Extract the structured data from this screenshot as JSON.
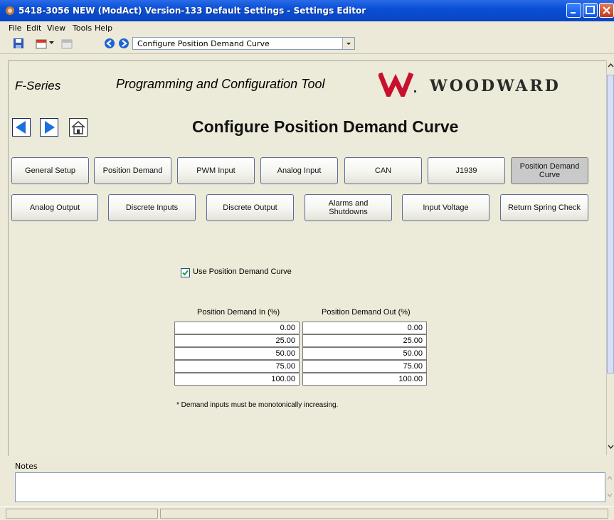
{
  "window": {
    "title": "5418-3056 NEW (ModAct) Version-133 Default Settings - Settings Editor"
  },
  "menu": [
    "File",
    "Edit",
    "View",
    "Tools",
    "Help"
  ],
  "toolbar": {
    "page_select": "Configure Position Demand Curve",
    "icons": [
      "save-icon",
      "calendar-icon",
      "calendar-disabled-icon",
      "back-circle-icon",
      "forward-circle-icon"
    ]
  },
  "header": {
    "series": "F-Series",
    "tool": "Programming and Configuration Tool",
    "brand": "WOODWARD"
  },
  "page": {
    "title": "Configure Position Demand Curve",
    "nav_icons": [
      "previous-arrow-icon",
      "next-arrow-icon",
      "home-icon"
    ]
  },
  "tabs_row1": [
    "General Setup",
    "Position Demand",
    "PWM Input",
    "Analog Input",
    "CAN",
    "J1939",
    "Position Demand Curve"
  ],
  "tabs_row2": [
    "Analog Output",
    "Discrete Inputs",
    "Discrete Output",
    "Alarms and Shutdowns",
    "Input Voltage",
    "Return Spring Check"
  ],
  "active_tab": "Position Demand Curve",
  "curve": {
    "use_label": "Use Position Demand Curve",
    "use_checked": true,
    "col_in": "Position Demand In (%)",
    "col_out": "Position Demand Out (%)",
    "rows": [
      {
        "in": "0.00",
        "out": "0.00"
      },
      {
        "in": "25.00",
        "out": "25.00"
      },
      {
        "in": "50.00",
        "out": "50.00"
      },
      {
        "in": "75.00",
        "out": "75.00"
      },
      {
        "in": "100.00",
        "out": "100.00"
      }
    ],
    "footnote": "* Demand inputs must be monotonically increasing."
  },
  "notes": {
    "label": "Notes",
    "value": ""
  },
  "colors": {
    "titlebar": "#0a4fd6",
    "background": "#ece9d8",
    "nav_blue": "#1c6fe0",
    "active_tab": "#c9c9c9"
  }
}
